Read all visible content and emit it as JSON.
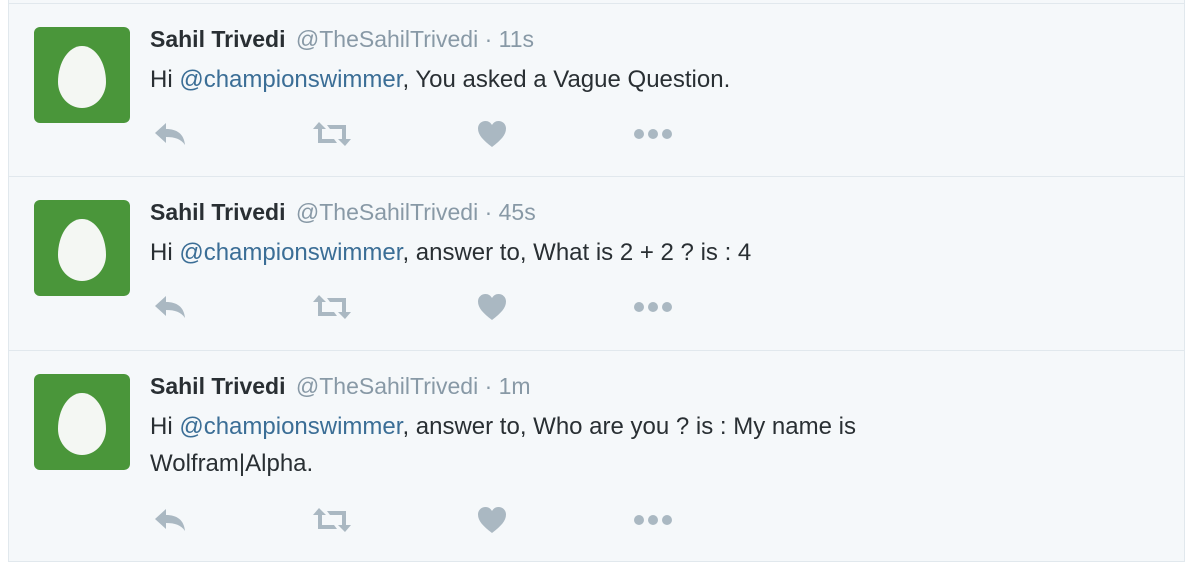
{
  "tweets": [
    {
      "name": "Sahil Trivedi",
      "handle": "@TheSahilTrivedi",
      "separator": "·",
      "time": "11s",
      "text_prefix": "Hi ",
      "mention": "@championswimmer",
      "text_rest": ", You asked a Vague Question."
    },
    {
      "name": "Sahil Trivedi",
      "handle": "@TheSahilTrivedi",
      "separator": "·",
      "time": "45s",
      "text_prefix": "Hi ",
      "mention": "@championswimmer",
      "text_rest": ", answer to, What is 2 + 2 ? is : 4"
    },
    {
      "name": "Sahil Trivedi",
      "handle": "@TheSahilTrivedi",
      "separator": "·",
      "time": "1m",
      "text_prefix": "Hi ",
      "mention": "@championswimmer",
      "text_rest": ", answer to, Who are you ? is : My name is Wolfram|Alpha."
    }
  ],
  "actions": {
    "reply_icon": "reply-icon",
    "retweet_icon": "retweet-icon",
    "like_icon": "heart-icon",
    "more_icon": "more-dots-icon",
    "icon_color": "#aab8c2"
  },
  "colors": {
    "avatar_bg": "#4a963a",
    "mention": "#3b6e96",
    "timeline_bg": "#f5f8fa"
  }
}
